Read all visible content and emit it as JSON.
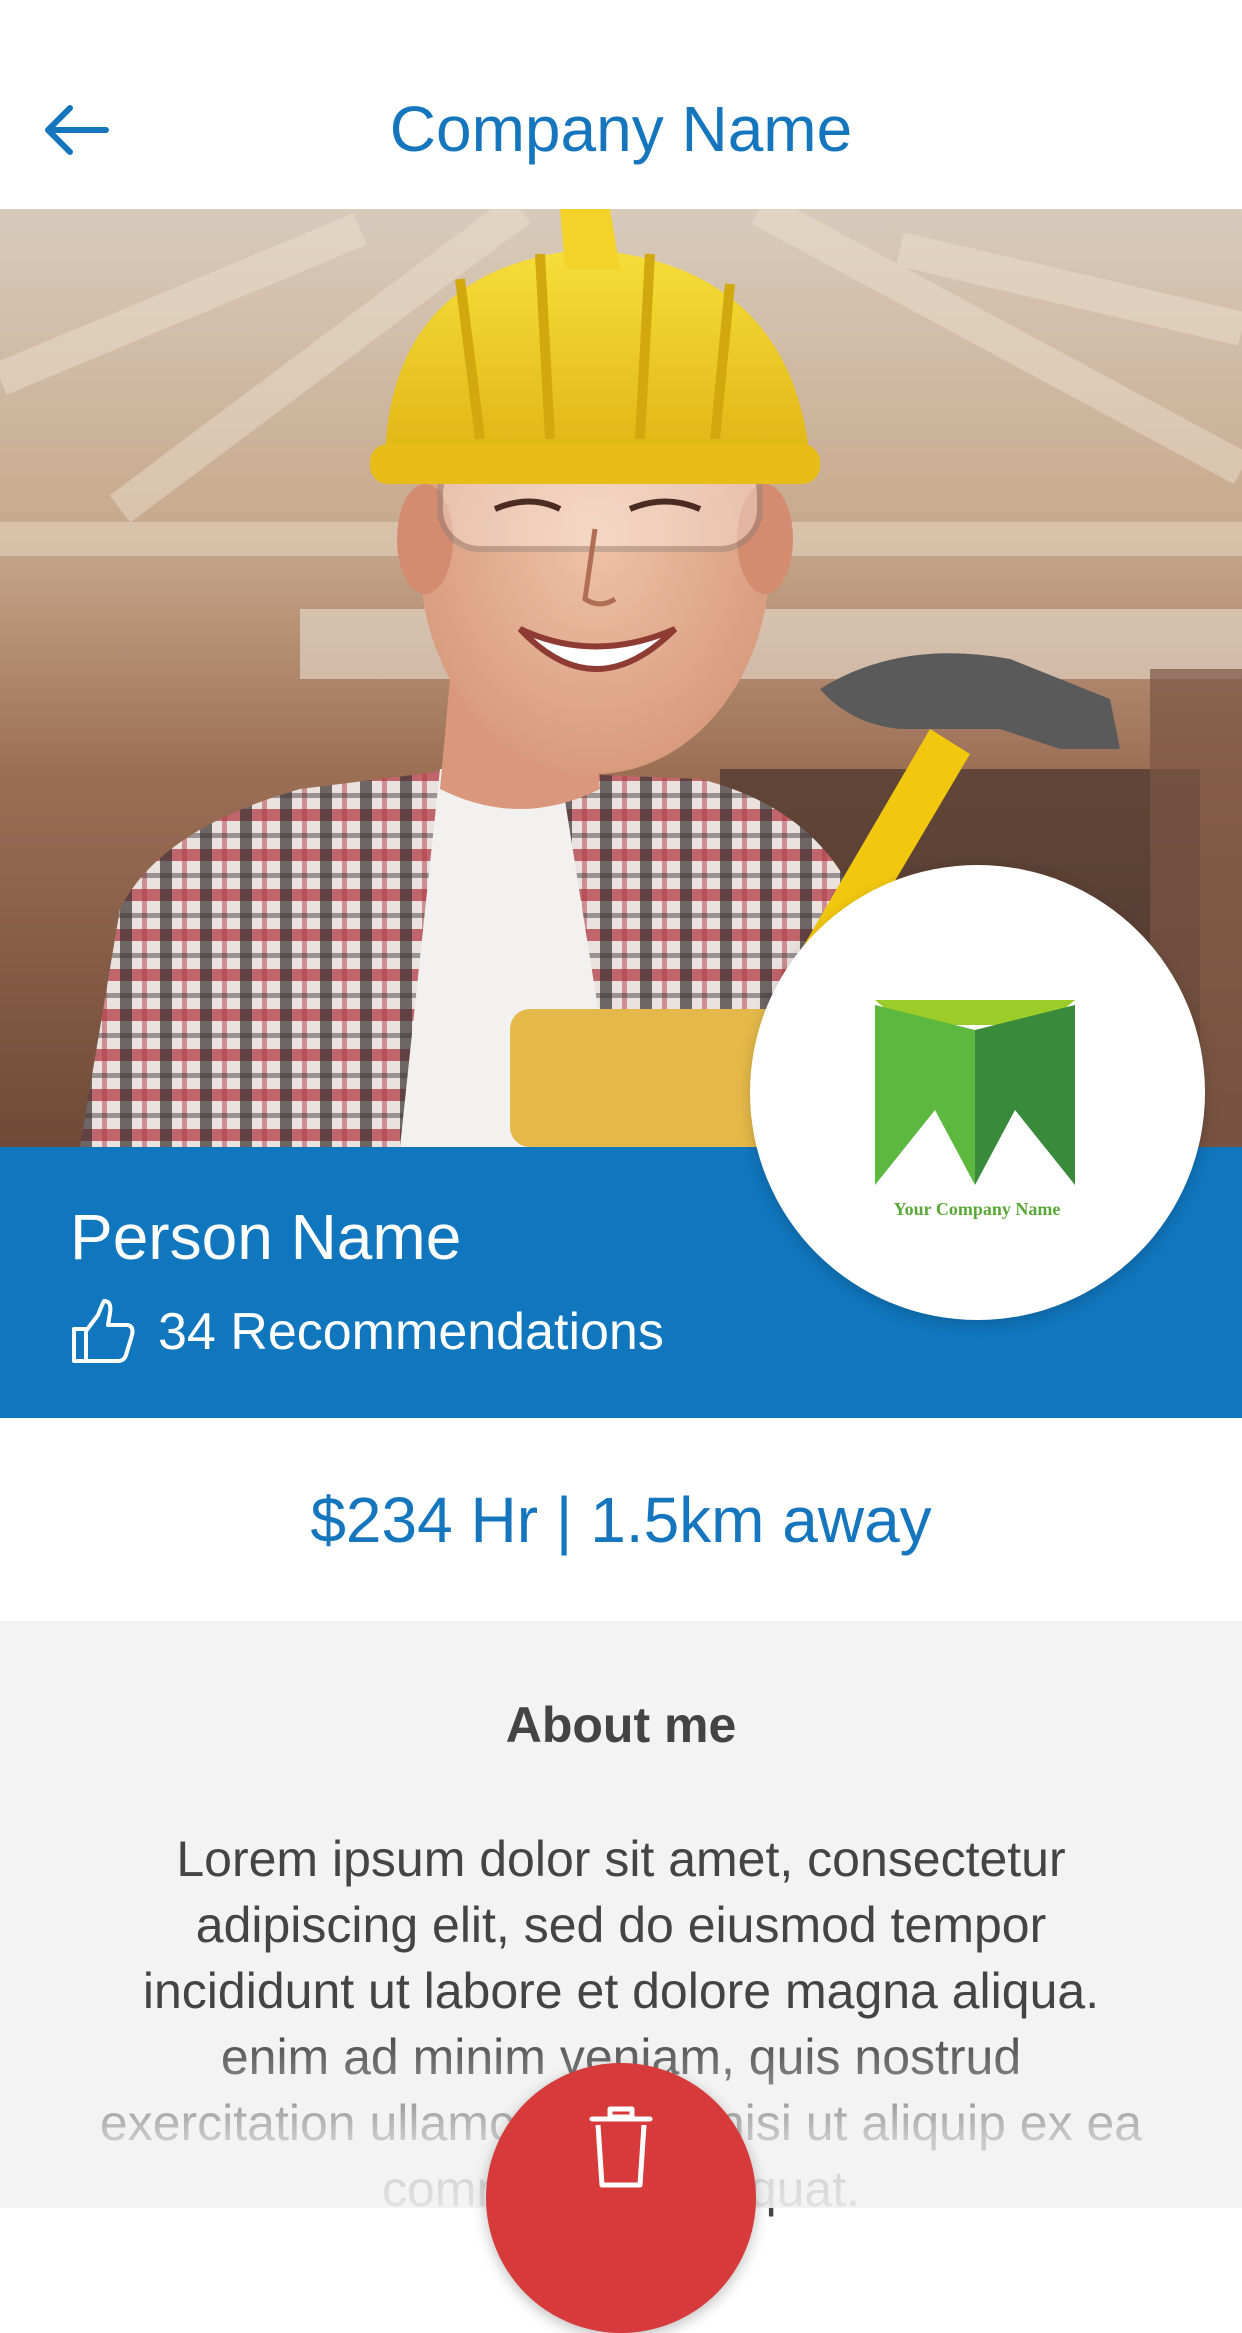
{
  "header": {
    "title": "Company Name",
    "back_icon": "arrow-left-icon"
  },
  "hero": {
    "photo": "construction worker with yellow hard hat, safety glasses and hammer"
  },
  "profile": {
    "name": "Person Name",
    "recommendations": "34 Recommendations",
    "recommend_icon": "thumbs-up-icon"
  },
  "logo": {
    "company_text": "Your Company Name",
    "colors": {
      "light_green": "#9ccc2a",
      "green": "#5cb83f",
      "dark_green": "#3a8a3c",
      "text": "#5aa838"
    }
  },
  "rate": {
    "text": "$234 Hr | 1.5km away"
  },
  "about": {
    "title": "About me",
    "body": "Lorem ipsum dolor sit amet, consectetur adipiscing elit, sed do eiusmod tempor incididunt ut labore et dolore magna aliqua. enim ad minim veniam, quis nostrud exercitation ullamco laboris nisi ut aliquip ex ea commodo consequat."
  },
  "fab": {
    "icon": "trash-icon"
  },
  "colors": {
    "primary_blue": "#1076bd",
    "delete_red": "#d63a3a",
    "about_bg": "#f3f3f3"
  }
}
